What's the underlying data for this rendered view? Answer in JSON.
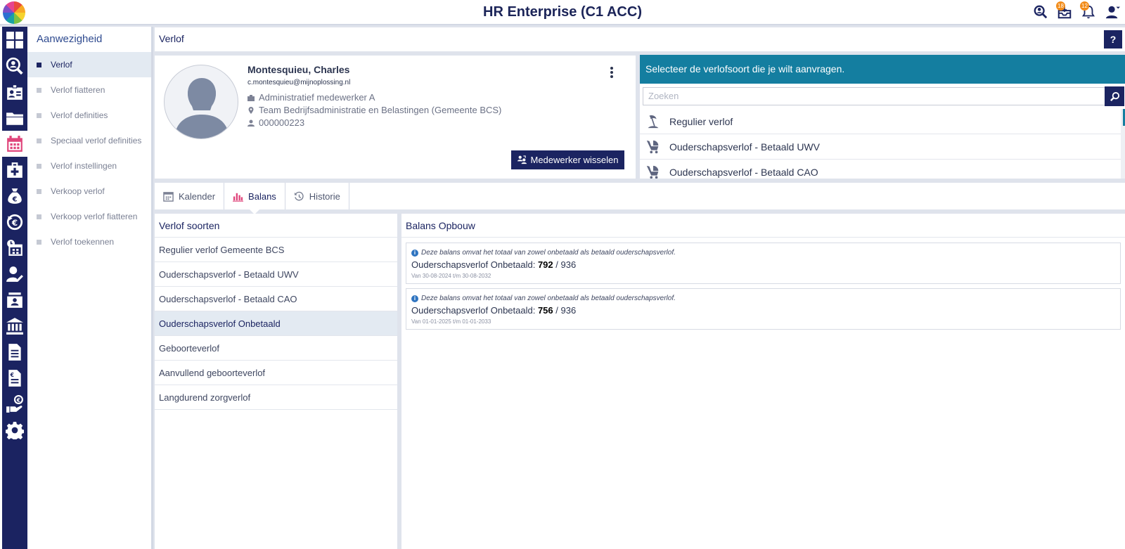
{
  "app": {
    "title": "HR Enterprise (C1 ACC)"
  },
  "topbar": {
    "inbox_badge": "18",
    "notifications_badge": "12"
  },
  "submenu": {
    "title": "Aanwezigheid",
    "items": [
      {
        "label": "Verlof",
        "active": true
      },
      {
        "label": "Verlof fiatteren"
      },
      {
        "label": "Verlof definities"
      },
      {
        "label": "Speciaal verlof definities"
      },
      {
        "label": "Verlof instellingen"
      },
      {
        "label": "Verkoop verlof"
      },
      {
        "label": "Verkoop verlof fiatteren"
      },
      {
        "label": "Verlof toekennen"
      }
    ]
  },
  "page": {
    "title": "Verlof",
    "help_label": "?"
  },
  "employee": {
    "name": "Montesquieu, Charles",
    "email": "c.montesquieu@mijnoplossing.nl",
    "function": "Administratief medewerker A",
    "team": "Team Bedrijfsadministratie en Belastingen (Gemeente BCS)",
    "number": "000000223",
    "switch_label": "Medewerker wisselen"
  },
  "leave_select": {
    "header": "Selecteer de verlofsoort die je wilt aanvragen.",
    "search_placeholder": "Zoeken",
    "items": [
      "Regulier verlof",
      "Ouderschapsverlof - Betaald UWV",
      "Ouderschapsverlof - Betaald CAO"
    ]
  },
  "tabs": [
    {
      "label": "Kalender",
      "icon": "calendar-icon"
    },
    {
      "label": "Balans",
      "icon": "bar-chart-icon",
      "active": true
    },
    {
      "label": "Historie",
      "icon": "history-icon"
    }
  ],
  "leave_types": {
    "title": "Verlof soorten",
    "items": [
      "Regulier verlof Gemeente BCS",
      "Ouderschapsverlof - Betaald UWV",
      "Ouderschapsverlof - Betaald CAO",
      "Ouderschapsverlof Onbetaald",
      "Geboorteverlof",
      "Aanvullend geboorteverlof",
      "Langdurend zorgverlof"
    ],
    "active_index": 3
  },
  "balance": {
    "title": "Balans Opbouw",
    "cards": [
      {
        "note": "Deze balans omvat het totaal van zowel onbetaald als betaald ouderschapsverlof.",
        "label": "Ouderschapsverlof Onbetaald:",
        "used": "792",
        "total": "/ 936",
        "range": "Van 30-08-2024 t/m 30-08-2032"
      },
      {
        "note": "Deze balans omvat het totaal van zowel onbetaald als betaald ouderschapsverlof.",
        "label": "Ouderschapsverlof Onbetaald:",
        "used": "756",
        "total": "/ 936",
        "range": "Van 01-01-2025 t/m 01-01-2033"
      }
    ]
  },
  "colors": {
    "navy": "#1b2461",
    "teal": "#147ea0",
    "accent": "#e0457b",
    "badge": "#f28c1a"
  }
}
